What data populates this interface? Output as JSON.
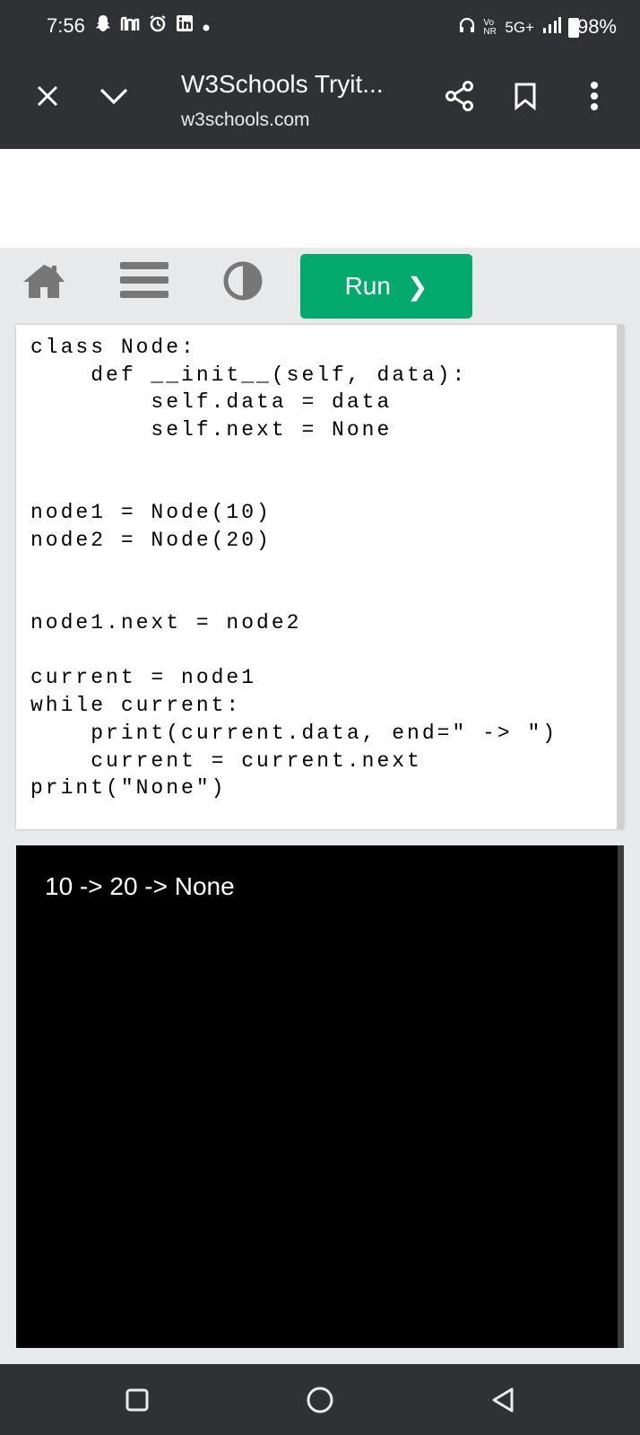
{
  "status": {
    "time": "7:56",
    "network": "5G+",
    "battery": "98%",
    "volte": "Vo NR"
  },
  "toolbar": {
    "title": "W3Schools Tryit...",
    "url": "w3schools.com"
  },
  "w3": {
    "run_label": "Run",
    "run_chevron": "❯"
  },
  "editor": {
    "code": "class Node:\n    def __init__(self, data):\n        self.data = data\n        self.next = None\n\n\nnode1 = Node(10)\nnode2 = Node(20)\n\n\nnode1.next = node2\n\ncurrent = node1\nwhile current:\n    print(current.data, end=\" -> \")\n    current = current.next\nprint(\"None\")"
  },
  "output": {
    "text": "10 -> 20 -> None"
  },
  "colors": {
    "run_green": "#04aa6d",
    "chrome_dark": "#303134"
  }
}
